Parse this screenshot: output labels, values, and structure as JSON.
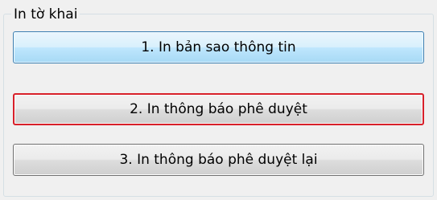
{
  "group": {
    "title": "In tờ khai"
  },
  "buttons": [
    {
      "label": "1. In bản sao thông tin",
      "state": "hover"
    },
    {
      "label": "2. In thông báo phê duyệt",
      "state": "focused"
    },
    {
      "label": "3. In thông báo phê duyệt lại",
      "state": "normal"
    }
  ],
  "colors": {
    "window_bg": "#f0f0f0",
    "group_border": "#d5dfe5",
    "hover_border": "#3c7fb1",
    "focus_border": "#d8202a"
  }
}
